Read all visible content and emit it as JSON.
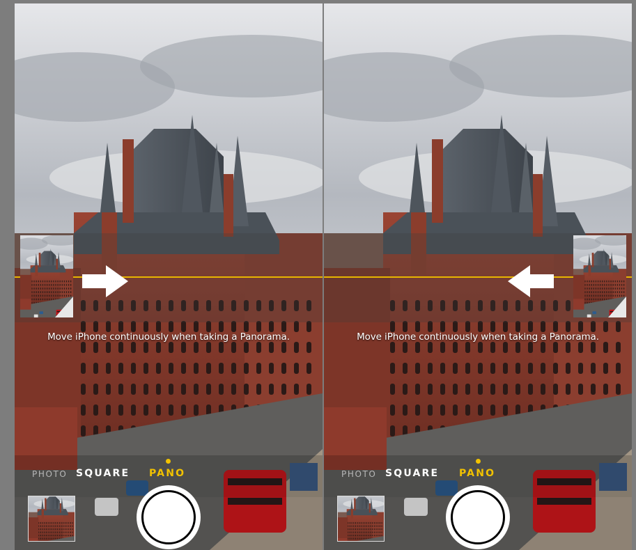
{
  "screens": [
    {
      "hint": "Move iPhone continuously when taking a Panorama.",
      "arrow_direction": "right",
      "modes": {
        "photo": "PHOTO",
        "square": "SQUARE",
        "pano": "PANO"
      },
      "active_mode": "PANO"
    },
    {
      "hint": "Move iPhone continuously when taking a Panorama.",
      "arrow_direction": "left",
      "modes": {
        "photo": "PHOTO",
        "square": "SQUARE",
        "pano": "PANO"
      },
      "active_mode": "PANO"
    }
  ],
  "colors": {
    "accent": "#f2c200",
    "guide_line": "#e8b500",
    "brick": "#8a3b2b",
    "slate_roof": "#4f565e",
    "sky": "#c9ccd1"
  },
  "icons": [
    "arrow-right-icon",
    "arrow-left-icon",
    "shutter-button",
    "gallery-thumbnail"
  ]
}
